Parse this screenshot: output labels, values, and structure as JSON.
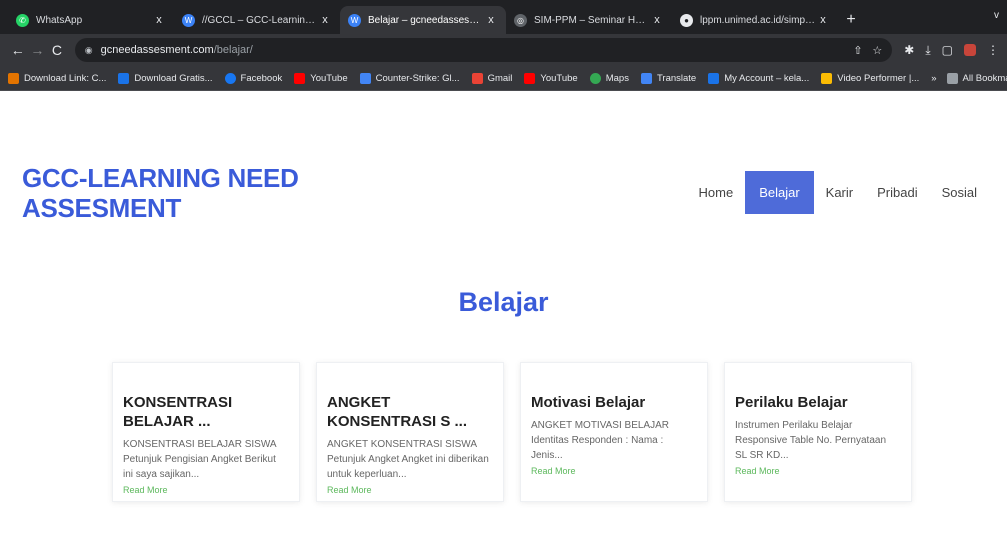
{
  "browser": {
    "tabs": [
      {
        "title": "WhatsApp",
        "close": "x",
        "icon_color": "#25d366",
        "active": false
      },
      {
        "title": "//GCCL – GCC-Learning.com",
        "close": "x",
        "icon_color": "#3b82f6",
        "active": false
      },
      {
        "title": "Belajar – gcneedassesment.c",
        "close": "x",
        "icon_color": "#3b82f6",
        "active": true
      },
      {
        "title": "SIM-PPM – Seminar Hasil",
        "close": "x",
        "icon_color": "#9aa0a6",
        "active": false
      },
      {
        "title": "lppm.unimed.ac.id/simppm/",
        "close": "x",
        "icon_color": "#e8eaed",
        "active": false
      }
    ],
    "new_tab": "+",
    "tab_menu": "v",
    "back": "←",
    "forward": "→",
    "reload": "C",
    "url_host": "gcneedassesment.com",
    "url_path": "/belajar/",
    "bookmarks": [
      {
        "label": "Download Link: C...",
        "icon_color": "#e37400"
      },
      {
        "label": "Download Gratis...",
        "icon_color": "#1a73e8"
      },
      {
        "label": "Facebook",
        "icon_color": "#1877f2"
      },
      {
        "label": "YouTube",
        "icon_color": "#ff0000"
      },
      {
        "label": "Counter-Strike: Gl...",
        "icon_color": "#4285f4"
      },
      {
        "label": "Gmail",
        "icon_color": "#ea4335"
      },
      {
        "label": "YouTube",
        "icon_color": "#ff0000"
      },
      {
        "label": "Maps",
        "icon_color": "#34a853"
      },
      {
        "label": "Translate",
        "icon_color": "#4285f4"
      },
      {
        "label": "My Account – kela...",
        "icon_color": "#1a73e8"
      },
      {
        "label": "Video Performer |...",
        "icon_color": "#fbbc04"
      }
    ],
    "bookmarks_more": "»",
    "all_bookmarks": "All Bookmarks"
  },
  "site": {
    "title_line1": "GCC-LEARNING NEED",
    "title_line2": "ASSESMENT",
    "nav": [
      {
        "label": "Home",
        "active": false
      },
      {
        "label": "Belajar",
        "active": true
      },
      {
        "label": "Karir",
        "active": false
      },
      {
        "label": "Pribadi",
        "active": false
      },
      {
        "label": "Sosial",
        "active": false
      }
    ],
    "section_title": "Belajar",
    "cards": [
      {
        "title": "KONSENTRASI BELAJAR ...",
        "excerpt": "KONSENTRASI BELAJAR SISWA Petunjuk Pengisian Angket Berikut ini saya sajikan...",
        "more": "Read More"
      },
      {
        "title": "ANGKET KONSENTRASI S ...",
        "excerpt": "ANGKET KONSENTRASI SISWA Petunjuk Angket Angket ini diberikan untuk keperluan...",
        "more": "Read More"
      },
      {
        "title": "Motivasi Belajar",
        "excerpt": "ANGKET MOTIVASI BELAJAR Identitas Responden : Nama : Jenis...",
        "more": "Read More"
      },
      {
        "title": "Perilaku Belajar",
        "excerpt": "Instrumen Perilaku Belajar Responsive Table No. Pernyataan SL SR KD...",
        "more": "Read More"
      }
    ]
  }
}
